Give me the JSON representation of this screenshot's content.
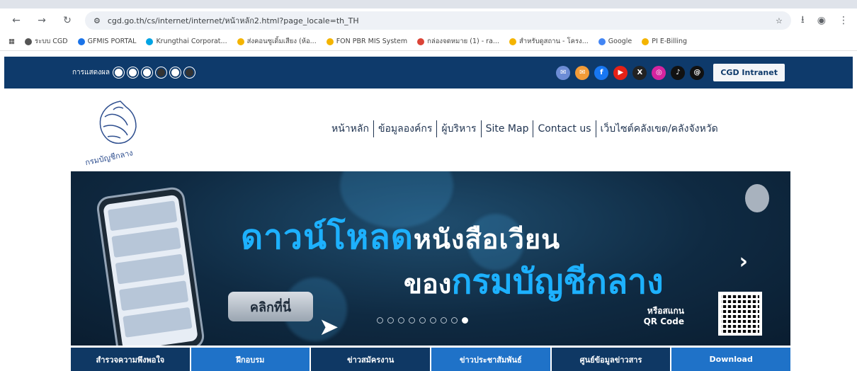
{
  "browser": {
    "url": "cgd.go.th/cs/internet/internet/หน้าหลัก2.html?page_locale=th_TH",
    "bookmarks": [
      {
        "label": "ระบบ CGD",
        "color": "#555"
      },
      {
        "label": "GFMIS PORTAL",
        "color": "#1a73e8"
      },
      {
        "label": "Krungthai Corporat...",
        "color": "#00a4e4"
      },
      {
        "label": "ส่งคอนซูเดิ้มเสียง (ห้อ...",
        "color": "#f4b400"
      },
      {
        "label": "FON PBR MIS System",
        "color": "#f4b400"
      },
      {
        "label": "กล่องจดหมาย (1) - ra...",
        "color": "#db4437"
      },
      {
        "label": "สำหรับดูสถาน - โครง...",
        "color": "#f4b400"
      },
      {
        "label": "Google",
        "color": "#4285f4"
      },
      {
        "label": "PI E-Billing",
        "color": "#f4b400"
      }
    ]
  },
  "topbar": {
    "display_mode_label": "การแสดงผล",
    "intranet_label": "CGD Intranet",
    "social": [
      {
        "icon": "email-icon",
        "glyph": "✉",
        "color": "#6c8cd5"
      },
      {
        "icon": "rss-icon",
        "glyph": "✉",
        "color": "#f29b38"
      },
      {
        "icon": "facebook-icon",
        "glyph": "f",
        "color": "#1877f2"
      },
      {
        "icon": "youtube-icon",
        "glyph": "▶",
        "color": "#e62117"
      },
      {
        "icon": "x-icon",
        "glyph": "X",
        "color": "#222"
      },
      {
        "icon": "instagram-icon",
        "glyph": "◎",
        "color": "#d6249f"
      },
      {
        "icon": "tiktok-icon",
        "glyph": "♪",
        "color": "#111"
      },
      {
        "icon": "threads-icon",
        "glyph": "@",
        "color": "#111"
      }
    ]
  },
  "nav": {
    "items": [
      "หน้าหลัก",
      "ข้อมูลองค์กร",
      "ผู้บริหาร",
      "Site Map",
      "Contact us",
      "เว็บไซต์คลังเขต/คลังจังหวัด"
    ]
  },
  "logo_text": "กรมบัญชีกลาง",
  "banner": {
    "headline_1": "ดาวน์โหลด",
    "headline_1b": "หนังสือเวียน",
    "headline_2a": "ของ",
    "headline_2b": "กรมบัญชีกลาง",
    "click_label": "คลิกที่นี่",
    "qr_text_1": "หรือสแกน",
    "qr_text_2": "QR Code",
    "slides_total": 9,
    "slide_active": 9
  },
  "tabs": [
    {
      "label": "สำรวจความพึงพอใจ",
      "style": "dark"
    },
    {
      "label": "ฝึกอบรม",
      "style": "light"
    },
    {
      "label": "ข่าวสมัครงาน",
      "style": "dark"
    },
    {
      "label": "ข่าวประชาสัมพันธ์",
      "style": "light"
    },
    {
      "label": "ศูนย์ข้อมูลข่าวสาร",
      "style": "dark"
    },
    {
      "label": "Download",
      "style": "light"
    }
  ]
}
